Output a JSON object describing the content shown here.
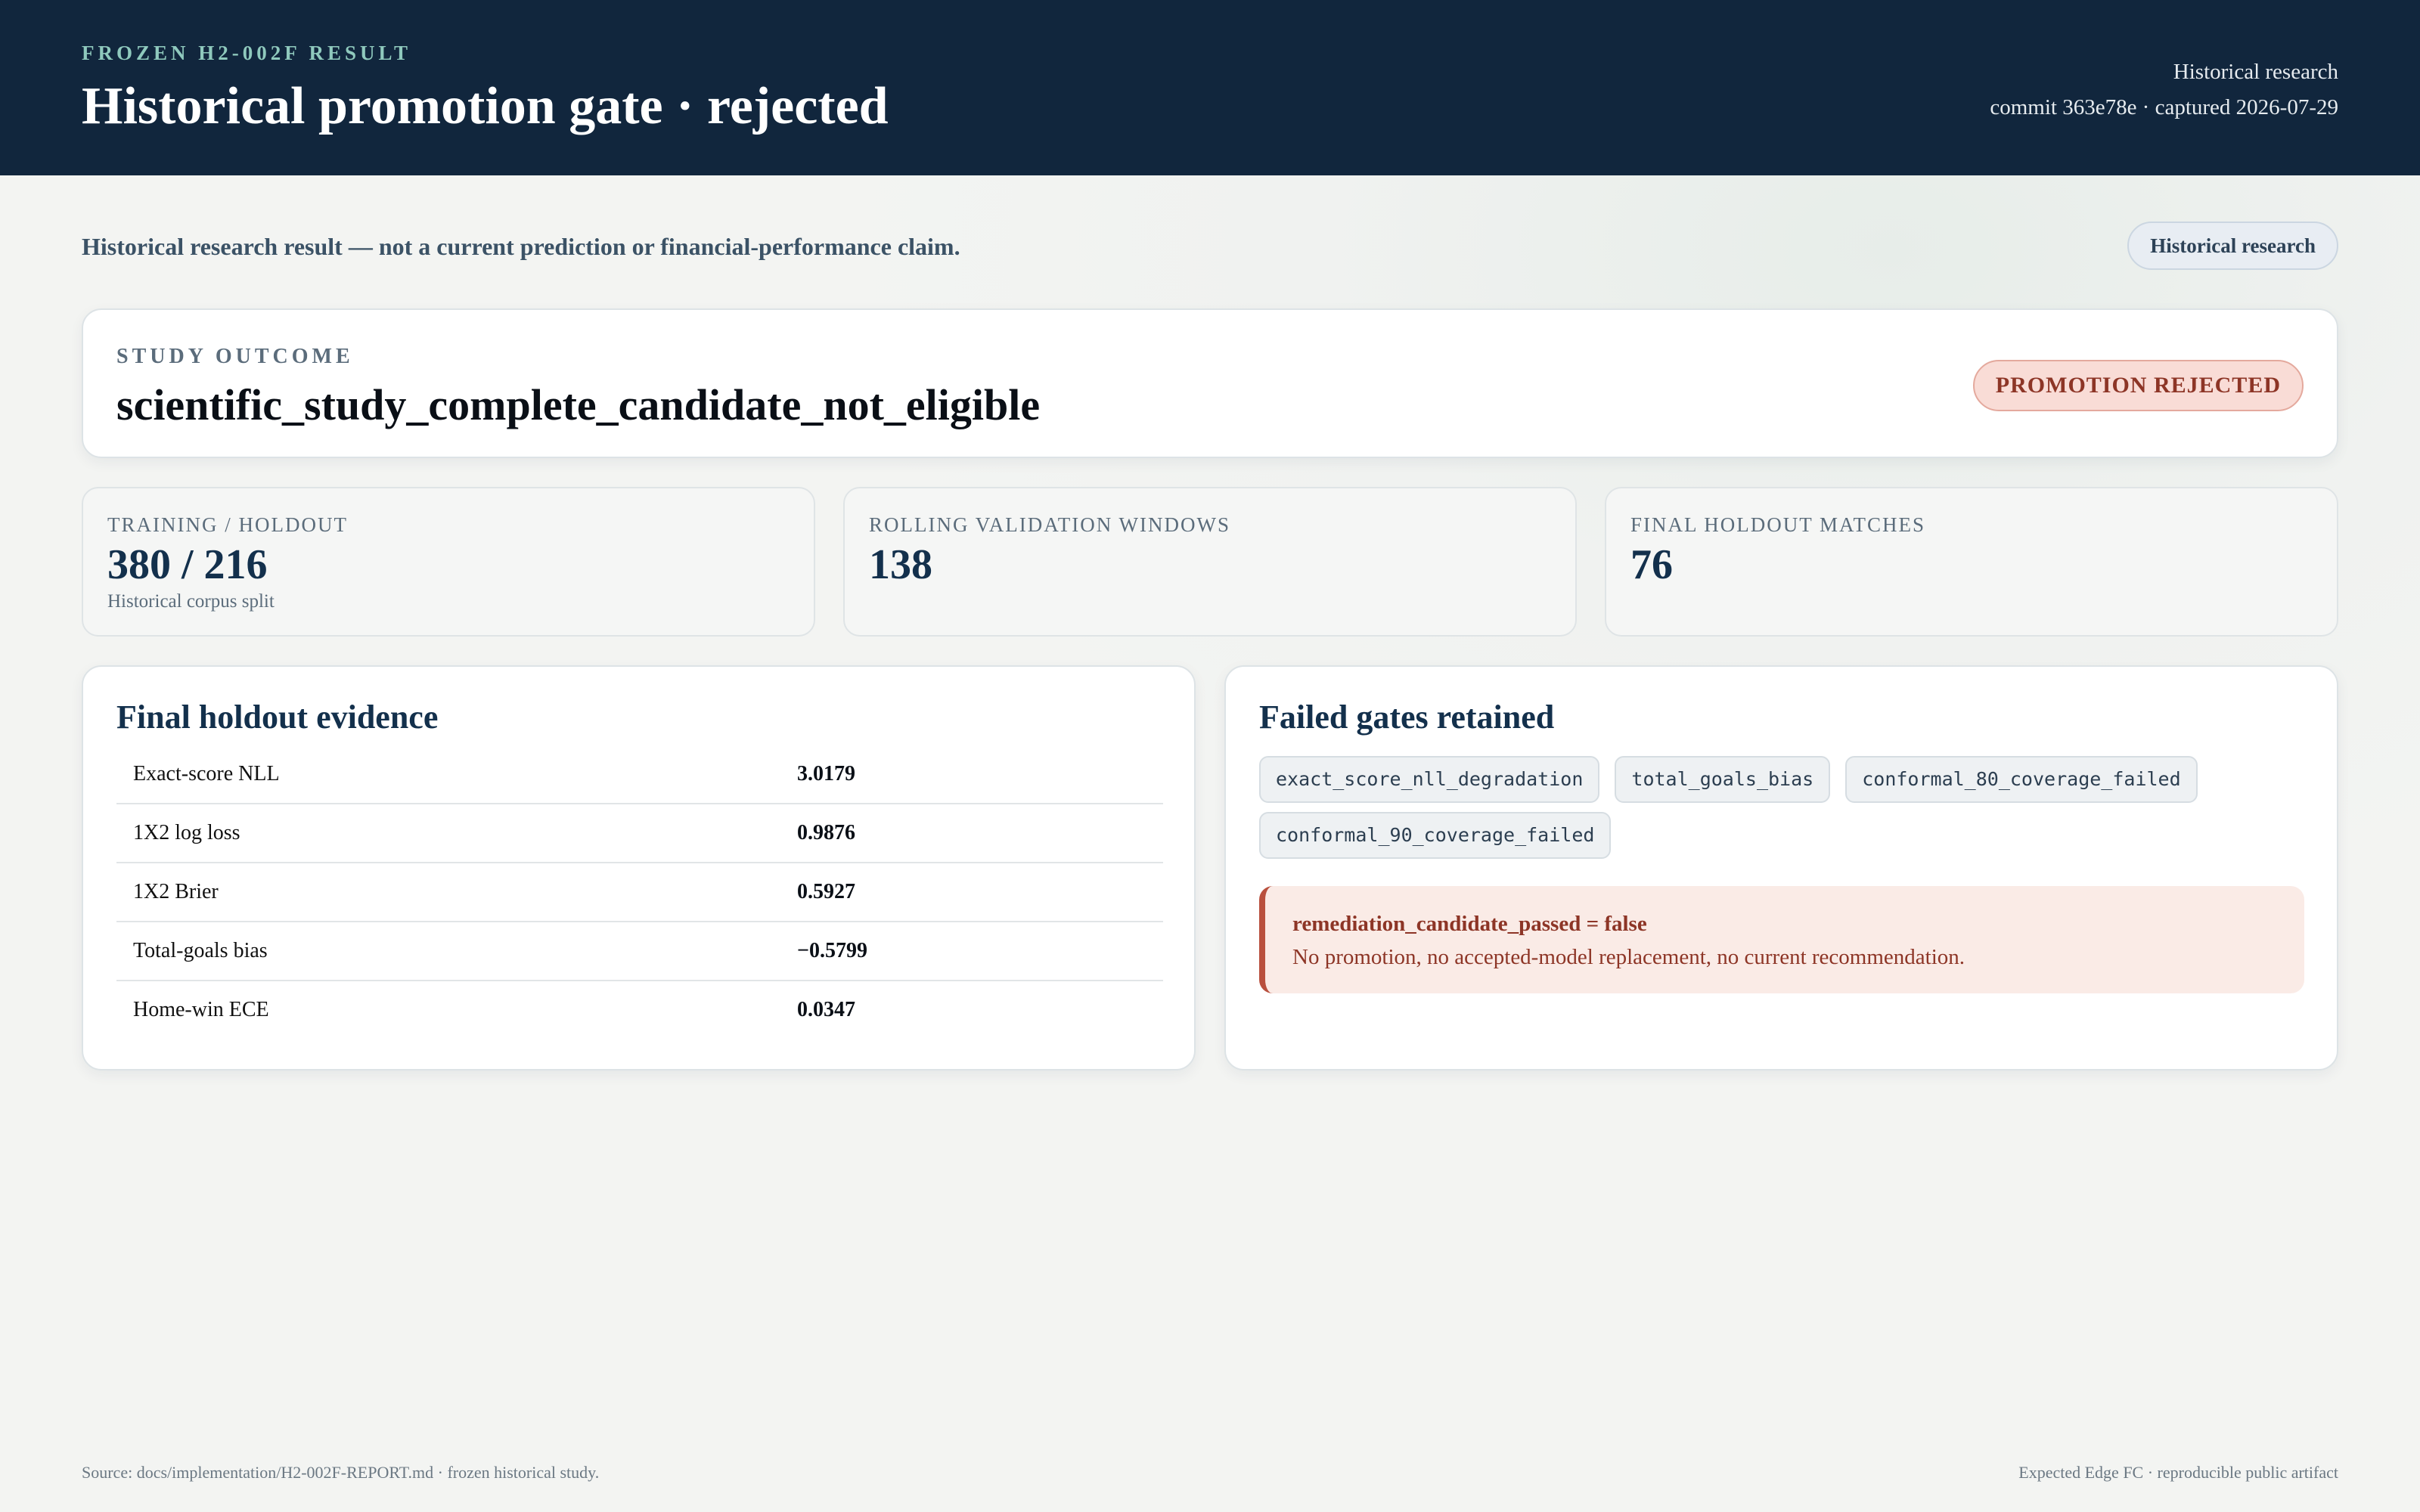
{
  "header": {
    "eyebrow": "FROZEN H2-002F RESULT",
    "title": "Historical promotion gate · rejected",
    "meta_line1": "Historical research",
    "meta_line2": "commit 363e78e · captured 2026-07-29"
  },
  "disclaimer": {
    "text": "Historical research result — not a current prediction or financial-performance claim.",
    "pill_label": "Historical research"
  },
  "study_outcome": {
    "label": "STUDY OUTCOME",
    "value": "scientific_study_complete_candidate_not_eligible",
    "badge": "PROMOTION REJECTED"
  },
  "stats": [
    {
      "label": "TRAINING / HOLDOUT",
      "value": "380 / 216",
      "note": "Historical corpus split"
    },
    {
      "label": "ROLLING VALIDATION WINDOWS",
      "value": "138",
      "note": ""
    },
    {
      "label": "FINAL HOLDOUT MATCHES",
      "value": "76",
      "note": ""
    }
  ],
  "evidence": {
    "title": "Final holdout evidence",
    "rows": [
      {
        "metric": "Exact-score NLL",
        "value": "3.0179"
      },
      {
        "metric": "1X2 log loss",
        "value": "0.9876"
      },
      {
        "metric": "1X2 Brier",
        "value": "0.5927"
      },
      {
        "metric": "Total-goals bias",
        "value": "−0.5799"
      },
      {
        "metric": "Home-win ECE",
        "value": "0.0347"
      }
    ]
  },
  "failed_gates": {
    "title": "Failed gates retained",
    "chips": [
      "exact_score_nll_degradation",
      "total_goals_bias",
      "conformal_80_coverage_failed",
      "conformal_90_coverage_failed"
    ],
    "remediation_title": "remediation_candidate_passed = false",
    "remediation_text": "No promotion, no accepted-model replacement, no current recommendation."
  },
  "footer": {
    "source": "Source: docs/implementation/H2-002F-REPORT.md · frozen historical study.",
    "credit": "Expected Edge FC · reproducible public artifact"
  },
  "colors": {
    "header_bg": "#11263d",
    "accent_teal": "#8fc9bd",
    "reject_red": "#8d3526",
    "reject_bg": "#f9dcd6"
  }
}
